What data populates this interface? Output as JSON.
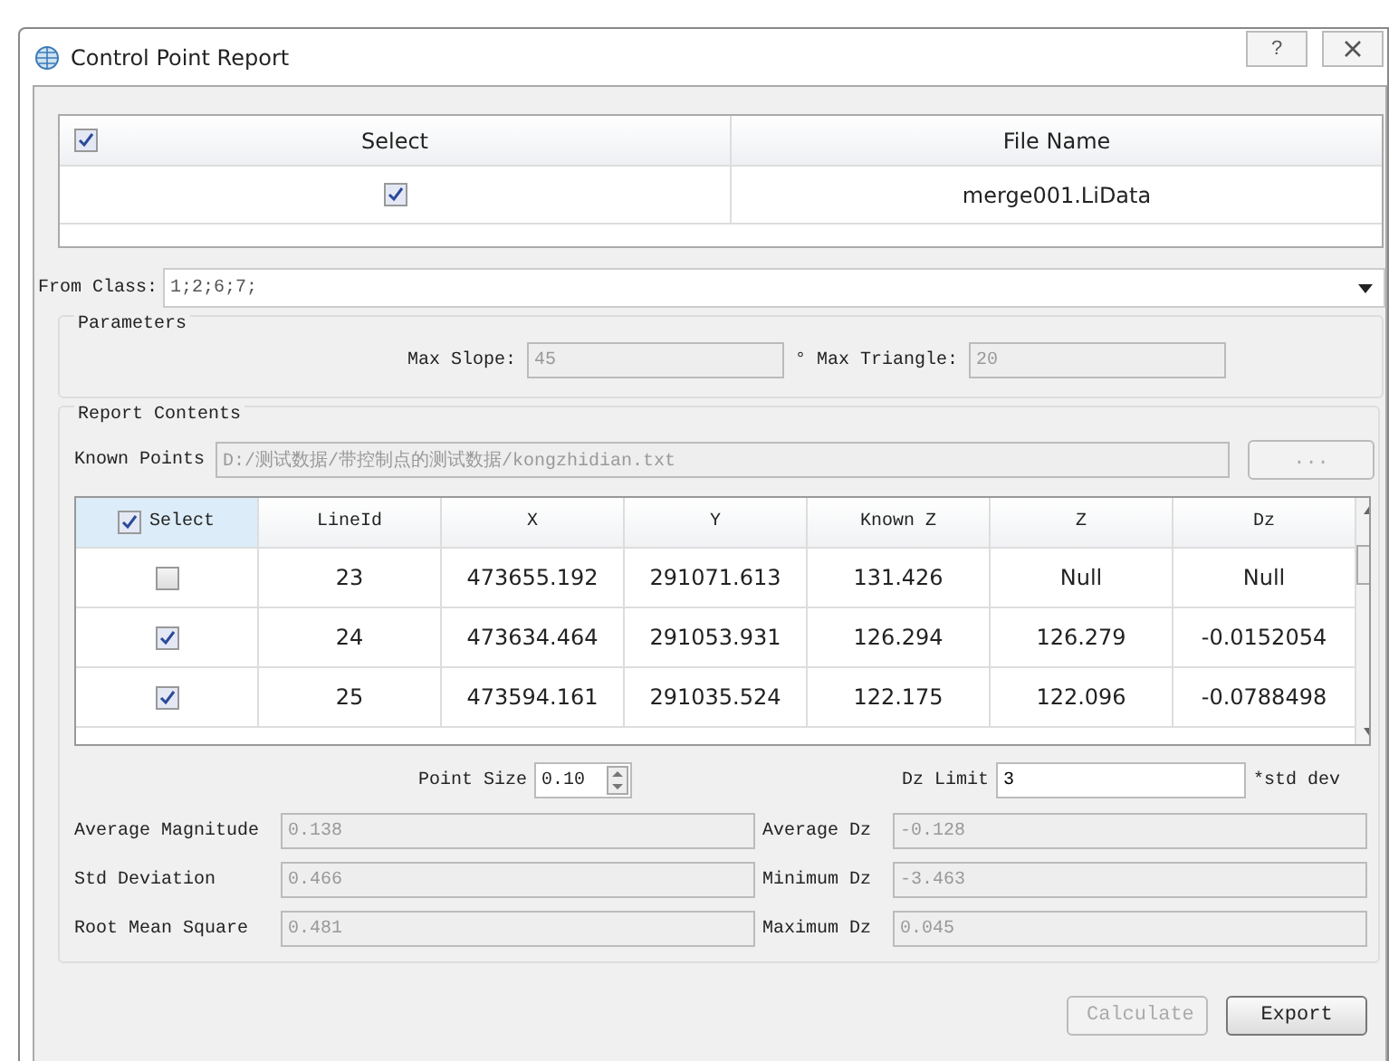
{
  "window": {
    "title": "Control Point Report",
    "help": "?"
  },
  "files": {
    "columns": [
      "Select",
      "File Name"
    ],
    "all_checked": true,
    "rows": [
      {
        "checked": true,
        "file": "merge001.LiData"
      }
    ]
  },
  "from_class": {
    "label": "From Class:",
    "value": "1;2;6;7;"
  },
  "parameters": {
    "title": "Parameters",
    "max_slope": {
      "label": "Max Slope:",
      "value": "45"
    },
    "degree": "°",
    "max_triangle": {
      "label": "Max Triangle:",
      "value": "20"
    }
  },
  "report": {
    "title": "Report Contents",
    "known_points": {
      "label": "Known Points",
      "value": "D:/测试数据/带控制点的测试数据/kongzhidian.txt",
      "browse": "..."
    },
    "select_header": "Select",
    "columns": [
      "LineId",
      "X",
      "Y",
      "Known Z",
      "Z",
      "Dz"
    ],
    "all_checked": true,
    "rows": [
      {
        "checked": false,
        "cells": [
          "23",
          "473655.192",
          "291071.613",
          "131.426",
          "Null",
          "Null"
        ]
      },
      {
        "checked": true,
        "cells": [
          "24",
          "473634.464",
          "291053.931",
          "126.294",
          "126.279",
          "-0.0152054"
        ]
      },
      {
        "checked": true,
        "cells": [
          "25",
          "473594.161",
          "291035.524",
          "122.175",
          "122.096",
          "-0.0788498"
        ]
      }
    ],
    "point_size": {
      "label": "Point Size",
      "value": "0.10"
    },
    "dz_limit": {
      "label": "Dz Limit",
      "value": "3",
      "unit": "*std dev"
    },
    "stats": [
      {
        "label": "Average Magnitude",
        "value": "0.138"
      },
      {
        "label": "Average Dz",
        "value": "-0.128"
      },
      {
        "label": "Std Deviation",
        "value": "0.466"
      },
      {
        "label": "Minimum Dz",
        "value": "-3.463"
      },
      {
        "label": "Root Mean Square",
        "value": "0.481"
      },
      {
        "label": "Maximum Dz",
        "value": "0.045"
      }
    ]
  },
  "buttons": [
    {
      "label": "Calculate",
      "disabled": true
    },
    {
      "label": "Export",
      "disabled": false
    }
  ]
}
